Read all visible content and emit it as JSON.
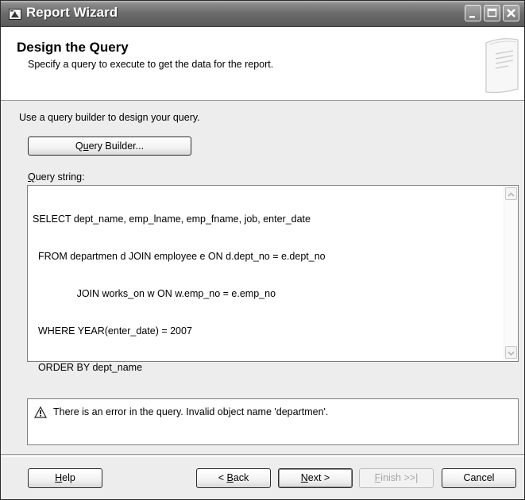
{
  "window": {
    "title": "Report Wizard"
  },
  "header": {
    "title": "Design the Query",
    "subtitle": "Specify a query to execute to get the data for the report."
  },
  "intro": {
    "text": "Use a query builder to design your query."
  },
  "query_builder_button": {
    "pre": "Q",
    "accel": "u",
    "post": "ery Builder..."
  },
  "query_label": {
    "accel": "Q",
    "post": "uery string:"
  },
  "query": {
    "lines": [
      "SELECT dept_name, emp_lname, emp_fname, job, enter_date",
      "  FROM departmen d JOIN employee e ON d.dept_no = e.dept_no",
      "                JOIN works_on w ON w.emp_no = e.emp_no",
      "  WHERE YEAR(enter_date) = 2007",
      "  ORDER BY dept_name"
    ]
  },
  "error": {
    "message": "There is an error in the query. Invalid object name 'departmen'."
  },
  "buttons": {
    "help": {
      "accel": "H",
      "post": "elp"
    },
    "back": {
      "pre": "< ",
      "accel": "B",
      "post": "ack"
    },
    "next": {
      "accel": "N",
      "post": "ext >"
    },
    "finish": {
      "accel": "F",
      "post": "inish >>|"
    },
    "cancel": {
      "label": "Cancel"
    }
  },
  "icons": {
    "app": "report-wizard-icon",
    "minimize": "minimize-icon",
    "maximize": "maximize-icon",
    "close": "close-icon",
    "header_art": "document-page-icon",
    "scroll_up": "chevron-up-icon",
    "scroll_down": "chevron-down-icon",
    "warning": "warning-icon"
  },
  "colors": {
    "titlebar": "#6b6b6b",
    "panel": "#ededed",
    "header_bg": "#ffffff",
    "disabled_text": "#a5a5a5"
  }
}
